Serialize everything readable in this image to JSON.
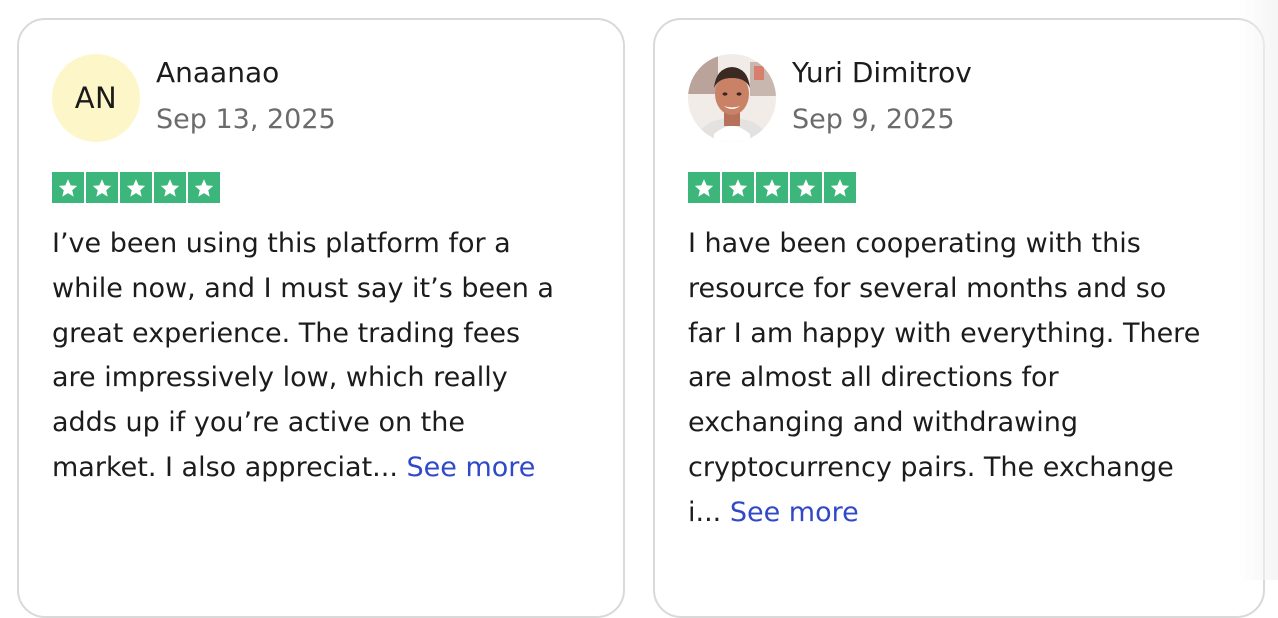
{
  "reviews": [
    {
      "author": "Anaanao",
      "initials": "AN",
      "date": "Sep 13, 2025",
      "rating": 5,
      "text": "I’ve been using this platform for a\nwhile now, and I must say it’s been a\ngreat experience. The trading fees\nare impressively low, which really\nadds up if you’re active on the\nmarket. I also appreciat... ",
      "see_more": "See more",
      "avatar_color": "#fdf6c9"
    },
    {
      "author": "Yuri Dimitrov",
      "date": "Sep 9, 2025",
      "rating": 5,
      "text": "I have been cooperating with this\nresource for several months and so\nfar I am happy with everything. There\nare almost all directions for\nexchanging and withdrawing\ncryptocurrency pairs. The exchange\ni... ",
      "see_more": "See more",
      "avatar_icon": "profile-photo"
    }
  ],
  "colors": {
    "star_green": "#3db67b",
    "link_blue": "#3049c9"
  }
}
